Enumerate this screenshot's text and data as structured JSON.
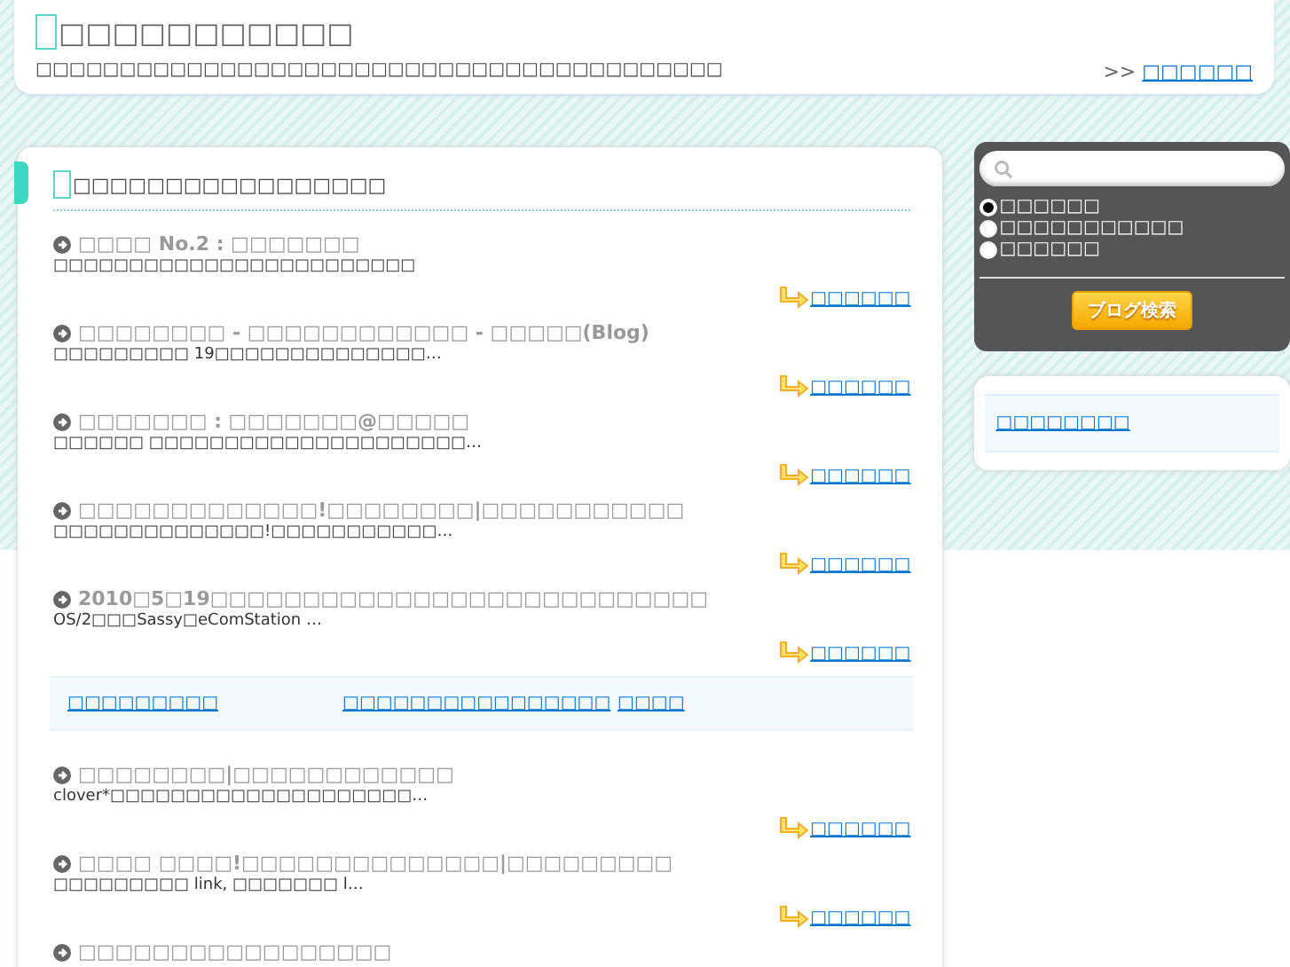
{
  "header": {
    "title": "□□□□□□□□□□□",
    "tagline": "□□□□□□□□□□□□□□□□□□□□□□□□□□□□□□□□□□□□□□□□□",
    "nav_prefix": ">>",
    "nav_link": "□□□□□□"
  },
  "main": {
    "heading": "□□□□□□□□□□□□□□□□□",
    "posts": [
      {
        "title": "□□□□ No.2 : □□□□□□□",
        "excerpt": "□□□□□□□□□□□□□□□□□□□□□□□□",
        "more": "□□□□□□"
      },
      {
        "title": "□□□□□□□□ - □□□□□□□□□□□□ - □□□□□(Blog)",
        "excerpt": "□□□□□□□□□ 19□□□□□□□□□□□□□□…",
        "more": "□□□□□□"
      },
      {
        "title": "□□□□□□□ : □□□□□□□@□□□□□",
        "excerpt": "□□□□□□ □□□□□□□□□□□□□□□□□□□□□…",
        "more": "□□□□□□"
      },
      {
        "title": "□□□□□□□□□□□□□!□□□□□□□□|□□□□□□□□□□□",
        "excerpt": "□□□□□□□□□□□□□□!□□□□□□□□□□□…",
        "more": "□□□□□□"
      },
      {
        "title": "2010□5□19□□□□□□□□□□□□□□□□□□□□□□□□□□□",
        "excerpt": "OS/2□□□Sassy□eComStation …",
        "more": "□□□□□□"
      }
    ],
    "links": [
      "□□□□□□□□□",
      "□□□□□□□□□□□□□□□□",
      "□□□□"
    ],
    "posts_after": [
      {
        "title": "□□□□□□□□|□□□□□□□□□□□□",
        "excerpt": "clover*□□□□□□□□□□□□□□□□□□□□…",
        "more": "□□□□□□"
      },
      {
        "title": "□□□□ □□□□!□□□□□□□□□□□□□□|□□□□□□□□□",
        "excerpt": "□□□□□□□□□ link, □□□□□□□ l…",
        "more": "□□□□□□"
      },
      {
        "title": "□□□□□□□□□□□□□□□□□"
      }
    ]
  },
  "sidebar": {
    "search": {
      "options": [
        {
          "label": "□□□□□□",
          "selected": true
        },
        {
          "label": "□□□□□□□□□□□",
          "selected": false
        },
        {
          "label": "□□□□□□",
          "selected": false
        }
      ],
      "button": "ブログ検索"
    },
    "widget_link": "□□□□□□□□"
  }
}
